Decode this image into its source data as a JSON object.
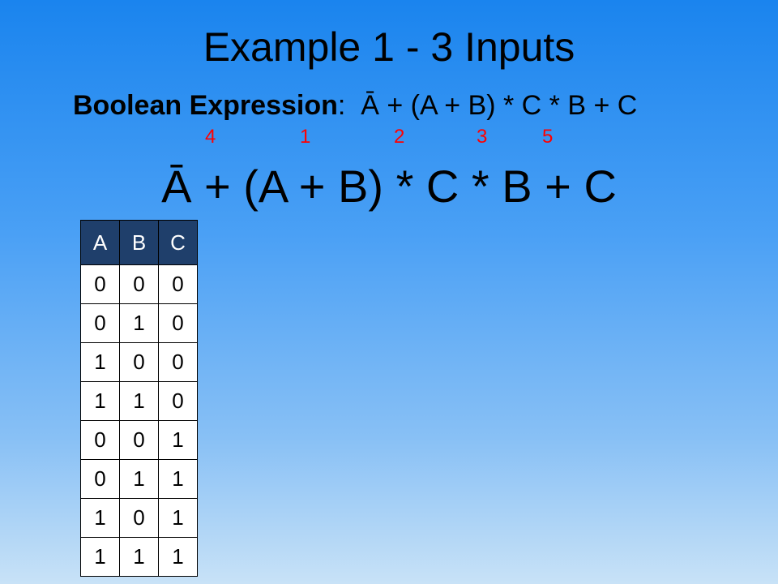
{
  "slide": {
    "title": "Example 1 - 3 Inputs",
    "expression_label": "Boolean Expression",
    "expression_colon": ":",
    "expression": "Ā + (A + B) * C * B + C",
    "operation_order": [
      "4",
      "1",
      "2",
      "3",
      "5"
    ],
    "large_expression": "Ā + (A + B) * C * B + C"
  },
  "truth_table": {
    "headers": [
      "A",
      "B",
      "C"
    ],
    "rows": [
      [
        "0",
        "0",
        "0"
      ],
      [
        "0",
        "1",
        "0"
      ],
      [
        "1",
        "0",
        "0"
      ],
      [
        "1",
        "1",
        "0"
      ],
      [
        "0",
        "0",
        "1"
      ],
      [
        "0",
        "1",
        "1"
      ],
      [
        "1",
        "0",
        "1"
      ],
      [
        "1",
        "1",
        "1"
      ]
    ]
  },
  "colors": {
    "order_numbers": "#ff0000",
    "table_header": "#1f3f6b"
  }
}
